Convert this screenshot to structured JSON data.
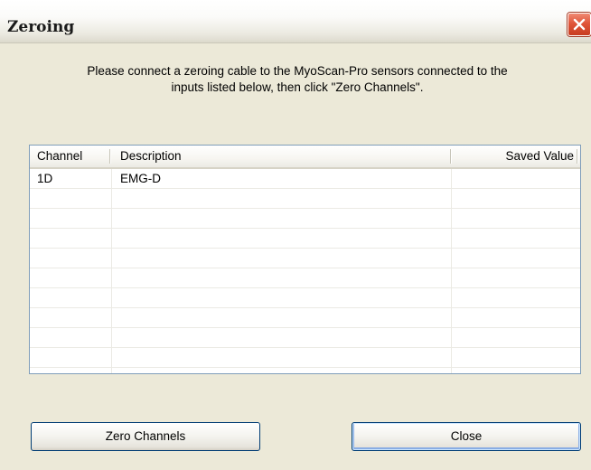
{
  "window": {
    "title": "Zeroing",
    "close_icon": "close-x-icon"
  },
  "instructions": {
    "line1": "Please connect a zeroing cable to the MyoScan-Pro sensors connected to the",
    "line2": "inputs listed below, then click \"Zero Channels\"."
  },
  "list": {
    "columns": [
      "Channel",
      "Description",
      "Saved Value"
    ],
    "rows": [
      [
        "1D",
        "EMG-D",
        ""
      ]
    ]
  },
  "buttons": {
    "zero_label": "Zero Channels",
    "close_label": "Close"
  },
  "colors": {
    "close_button": "#e0563a",
    "button_border": "#003c74",
    "list_border": "#7f9db9",
    "window_bg": "#ece9d8"
  }
}
